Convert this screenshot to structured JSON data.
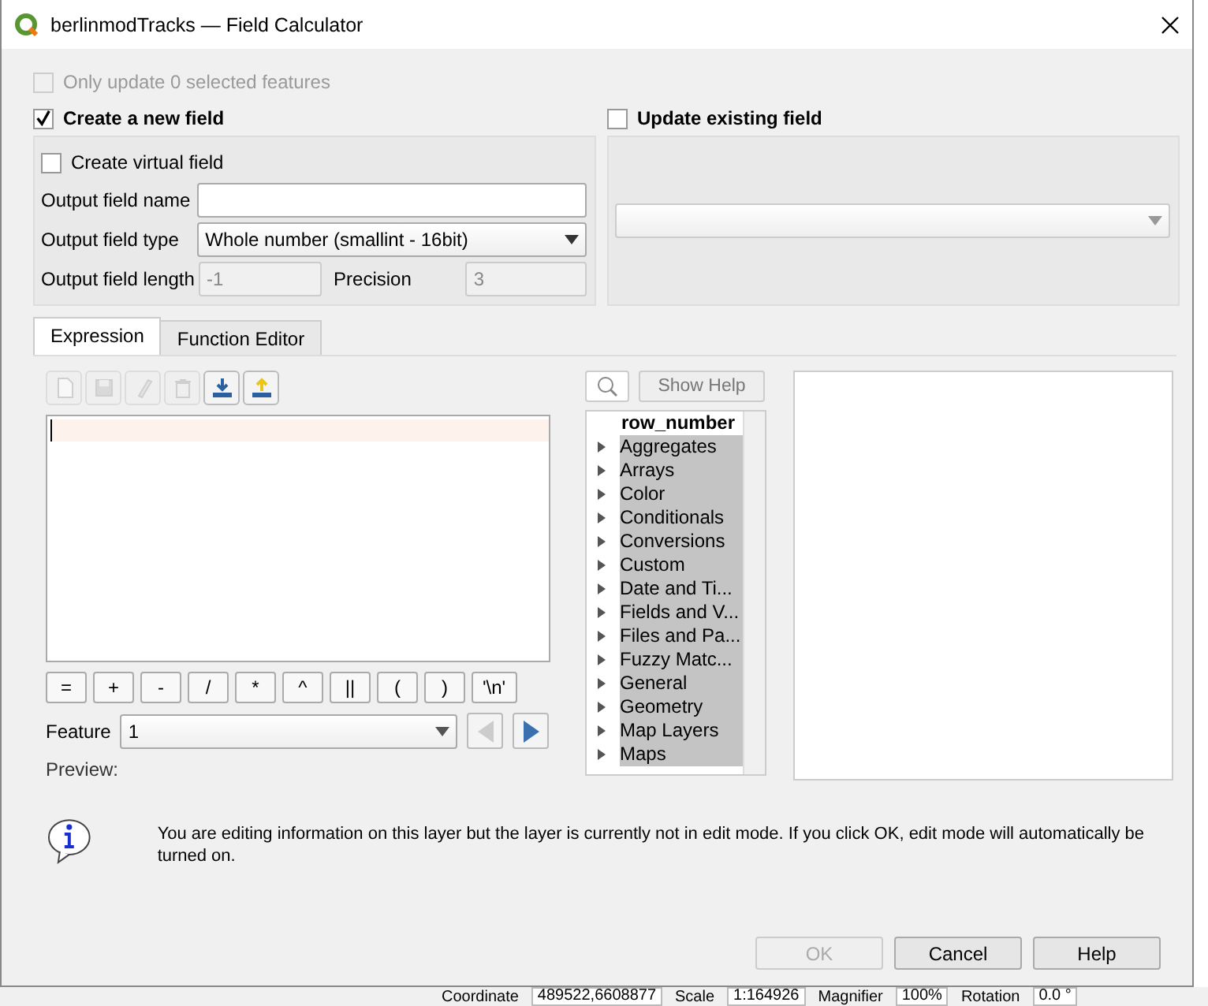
{
  "window": {
    "title": "berlinmodTracks — Field Calculator"
  },
  "only_selected": {
    "label": "Only update 0 selected features",
    "checked": false,
    "disabled": true
  },
  "create_new": {
    "label": "Create a new field",
    "checked": true
  },
  "virtual": {
    "label": "Create virtual field",
    "checked": false
  },
  "output_name": {
    "label": "Output field name"
  },
  "output_type": {
    "label": "Output field type",
    "value": "Whole number (smallint - 16bit)"
  },
  "output_length": {
    "label": "Output field length",
    "value": "-1",
    "disabled": true
  },
  "precision": {
    "label": "Precision",
    "value": "3",
    "disabled": true
  },
  "update_existing": {
    "label": "Update existing field",
    "checked": false
  },
  "tabs": [
    {
      "label": "Expression",
      "selected": true
    },
    {
      "label": "Function Editor",
      "selected": false
    }
  ],
  "toolbar": [
    {
      "kind": "new",
      "disabled": true
    },
    {
      "kind": "save",
      "disabled": true
    },
    {
      "kind": "edit",
      "disabled": true
    },
    {
      "kind": "delete",
      "disabled": true
    },
    {
      "kind": "import",
      "disabled": false
    },
    {
      "kind": "export",
      "disabled": false
    }
  ],
  "operators": [
    "=",
    "+",
    "-",
    "/",
    "*",
    "^",
    "||",
    "(",
    ")",
    "'\\n'"
  ],
  "feature": {
    "label": "Feature",
    "value": "1"
  },
  "preview": {
    "label": "Preview:"
  },
  "show_help": {
    "label": "Show Help"
  },
  "functions": {
    "header": "row_number",
    "groups": [
      "Aggregates",
      "Arrays",
      "Color",
      "Conditionals",
      "Conversions",
      "Custom",
      "Date and Ti...",
      "Fields and V...",
      "Files and Pa...",
      "Fuzzy Matc...",
      "General",
      "Geometry",
      "Map Layers",
      "Maps"
    ]
  },
  "message": "You are editing information on this layer but the layer is currently not in edit mode. If you click OK, edit mode will automatically be turned on.",
  "buttons": [
    {
      "label": "OK",
      "disabled": true
    },
    {
      "label": "Cancel",
      "disabled": false
    },
    {
      "label": "Help",
      "disabled": false
    }
  ],
  "status_bar": [
    {
      "label": "Coordinate",
      "value": "489522,6608877"
    },
    {
      "label": "Scale",
      "value": "1:164926"
    },
    {
      "label": "Magnifier",
      "value": "100%"
    },
    {
      "label": "Rotation",
      "value": "0.0 °"
    }
  ]
}
